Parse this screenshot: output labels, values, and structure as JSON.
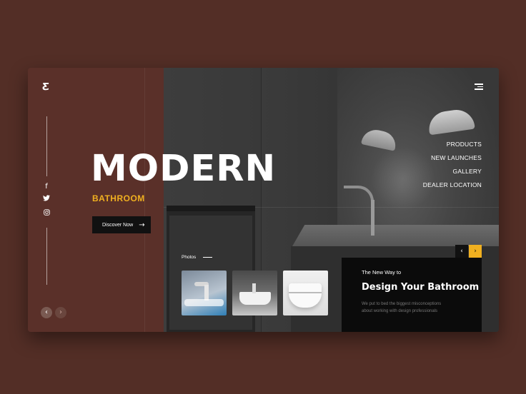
{
  "brand": {
    "logo_glyph": "Ƹ"
  },
  "social": {
    "facebook": "f",
    "twitter": "🐦",
    "instagram": "◎"
  },
  "hero": {
    "title": "MODERN",
    "subtitle": "BATHROOM",
    "cta_label": "Discover Now",
    "cta_arrow": "→"
  },
  "nav": {
    "items": [
      "PRODUCTS",
      "NEW LAUNCHES",
      "GALLERY",
      "DEALER LOCATION"
    ]
  },
  "photos": {
    "label": "Photos"
  },
  "feature": {
    "kicker": "The New Way to",
    "title": "Design Your Bathroom",
    "desc_line1": "We put to bed the biggest misconceptions",
    "desc_line2": "about working with design professionals"
  },
  "slider": {
    "prev": "‹",
    "next": "›"
  },
  "pager": {
    "prev": "‹",
    "next": "›"
  },
  "colors": {
    "background": "#532e26",
    "panel": "#5a3029",
    "accent": "#f0b020",
    "dark": "#0b0b0b"
  }
}
